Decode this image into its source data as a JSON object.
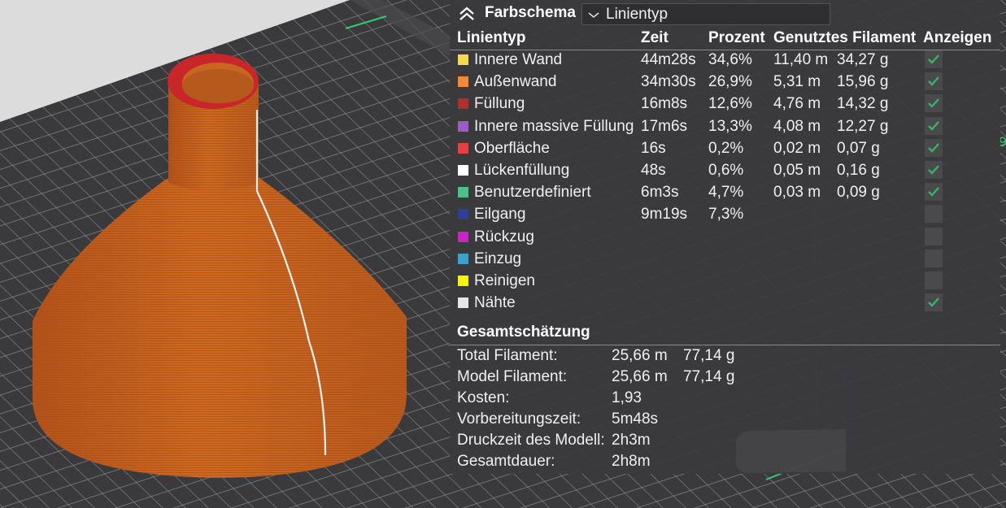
{
  "panel": {
    "title": "Farbschema",
    "scheme_value": "Linientyp"
  },
  "table": {
    "headers": {
      "type": "Linientyp",
      "time": "Zeit",
      "percent": "Prozent",
      "filament": "Genutztes Filament",
      "show": "Anzeigen"
    },
    "rows": [
      {
        "color": "#f5d94a",
        "name": "Innere Wand",
        "time": "44m28s",
        "percent": "34,6%",
        "length": "11,40 m",
        "weight": "34,27 g",
        "shown": true
      },
      {
        "color": "#f08a3a",
        "name": "Außenwand",
        "time": "34m30s",
        "percent": "26,9%",
        "length": "5,31 m",
        "weight": "15,96 g",
        "shown": true
      },
      {
        "color": "#b03030",
        "name": "Füllung",
        "time": "16m8s",
        "percent": "12,6%",
        "length": "4,76 m",
        "weight": "14,32 g",
        "shown": true
      },
      {
        "color": "#9a5cc6",
        "name": "Innere massive Füllung",
        "time": "17m6s",
        "percent": "13,3%",
        "length": "4,08 m",
        "weight": "12,27 g",
        "shown": true
      },
      {
        "color": "#e84040",
        "name": "Oberfläche",
        "time": "16s",
        "percent": "0,2%",
        "length": "0,02 m",
        "weight": "0,07 g",
        "shown": true
      },
      {
        "color": "#ffffff",
        "name": "Lückenfüllung",
        "time": "48s",
        "percent": "0,6%",
        "length": "0,05 m",
        "weight": "0,16 g",
        "shown": true
      },
      {
        "color": "#4fbf8a",
        "name": "Benutzerdefiniert",
        "time": "6m3s",
        "percent": "4,7%",
        "length": "0,03 m",
        "weight": "0,09 g",
        "shown": true
      },
      {
        "color": "#2f3e96",
        "name": "Eilgang",
        "time": "9m19s",
        "percent": "7,3%",
        "length": "",
        "weight": "",
        "shown": false
      },
      {
        "color": "#cc22cc",
        "name": "Rückzug",
        "time": "",
        "percent": "",
        "length": "",
        "weight": "",
        "shown": false
      },
      {
        "color": "#3aa3c8",
        "name": "Einzug",
        "time": "",
        "percent": "",
        "length": "",
        "weight": "",
        "shown": false
      },
      {
        "color": "#f5f500",
        "name": "Reinigen",
        "time": "",
        "percent": "",
        "length": "",
        "weight": "",
        "shown": false
      },
      {
        "color": "#e6e6e6",
        "name": "Nähte",
        "time": "",
        "percent": "",
        "length": "",
        "weight": "",
        "shown": true
      }
    ]
  },
  "summary": {
    "title": "Gesamtschätzung",
    "rows": [
      {
        "label": "Total Filament:",
        "value": "25,66 m",
        "weight": "77,14 g"
      },
      {
        "label": "Model Filament:",
        "value": "25,66 m",
        "weight": "77,14 g"
      },
      {
        "label": "Kosten:",
        "value": "1,93",
        "weight": ""
      },
      {
        "label": "Vorbereitungszeit:",
        "value": "5m48s",
        "weight": ""
      },
      {
        "label": "Druckzeit des Modell:",
        "value": "2h3m",
        "weight": ""
      },
      {
        "label": "Gesamtdauer:",
        "value": "2h8m",
        "weight": ""
      }
    ]
  },
  "colors": {
    "model": "#c8611d",
    "plate": "#3d3d3f",
    "check": "#3ab26a",
    "axis_x": "#2ecc71",
    "axis_z": "#1f2a7a"
  },
  "icons": {
    "collapse": "chevrons-up-icon",
    "dropdown": "chevron-down-icon",
    "check": "checkmark-icon"
  }
}
